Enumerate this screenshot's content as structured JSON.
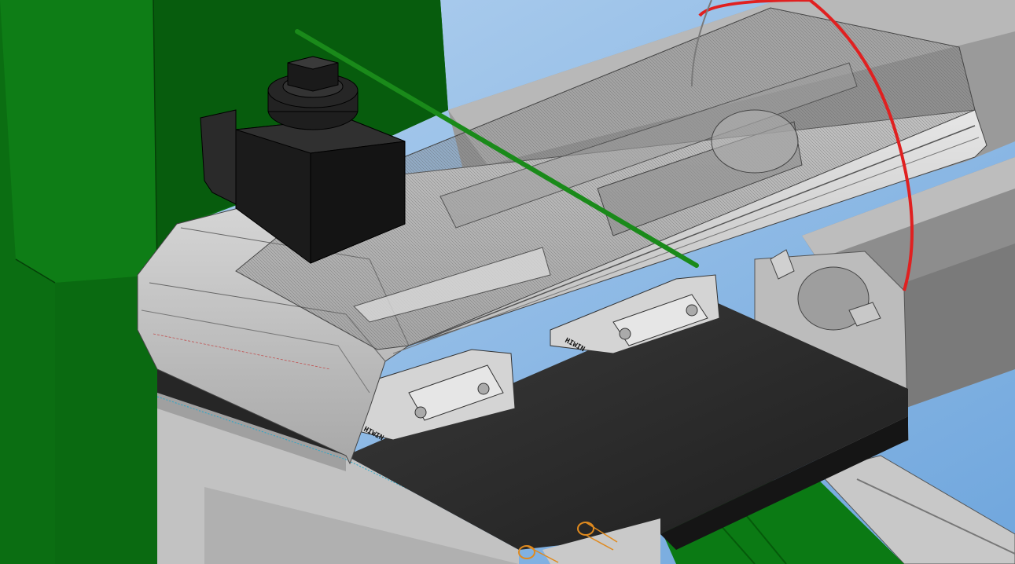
{
  "viewport": {
    "background_top": "#b6d3f0",
    "background_bottom": "#6fa6dd"
  },
  "colors": {
    "frame_green": "#0b6e12",
    "frame_green_dark": "#054a09",
    "actuator_dark": "#1b1b1b",
    "plate_dark": "#2a2a2a",
    "profile_gray": "#c9c9c9",
    "profile_gray_dark": "#9a9a9a",
    "transparent_cover": "#8f8f8f",
    "red_cable": "#e02020",
    "green_rod": "#1a8a1a",
    "orange_pins": "#e08a1e"
  },
  "model": {
    "parts": [
      {
        "name": "green-frame-column"
      },
      {
        "name": "linear-guide-carriage"
      },
      {
        "name": "rectangular-tube-profile"
      },
      {
        "name": "dark-base-plate"
      },
      {
        "name": "transparent-housing"
      },
      {
        "name": "drive-motor"
      },
      {
        "name": "guide-rod"
      },
      {
        "name": "cable-loop"
      },
      {
        "name": "dowel-pins"
      }
    ],
    "brand_marks": [
      "HIWIN",
      "HIWIN"
    ]
  }
}
